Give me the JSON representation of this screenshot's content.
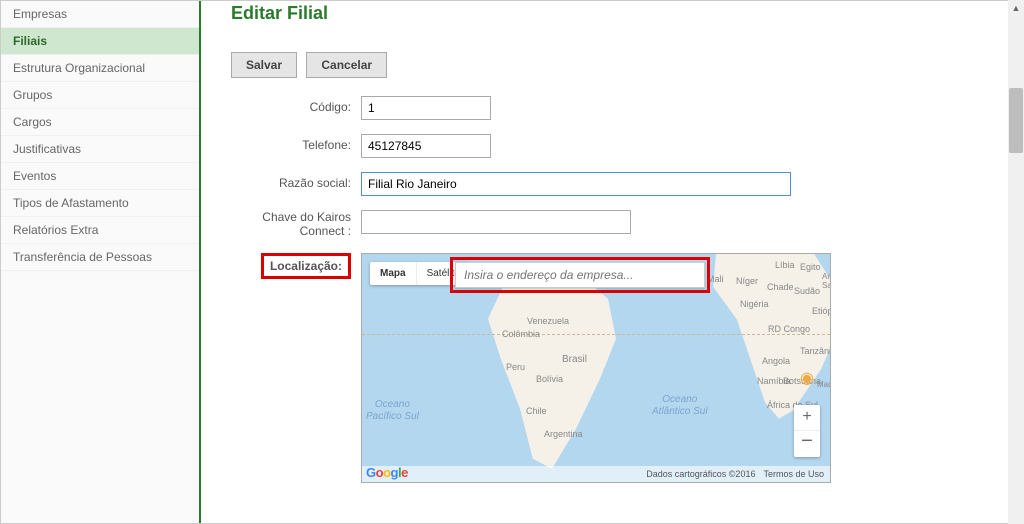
{
  "sidebar": {
    "items": [
      {
        "label": "Empresas"
      },
      {
        "label": "Filiais",
        "active": true
      },
      {
        "label": "Estrutura Organizacional"
      },
      {
        "label": "Grupos"
      },
      {
        "label": "Cargos"
      },
      {
        "label": "Justificativas"
      },
      {
        "label": "Eventos"
      },
      {
        "label": "Tipos de Afastamento"
      },
      {
        "label": "Relatórios Extra"
      },
      {
        "label": "Transferência de Pessoas"
      }
    ]
  },
  "page": {
    "title": "Editar Filial"
  },
  "buttons": {
    "save": "Salvar",
    "cancel": "Cancelar"
  },
  "form": {
    "codigo": {
      "label": "Código:",
      "value": "1"
    },
    "telefone": {
      "label": "Telefone:",
      "value": "45127845"
    },
    "razao": {
      "label": "Razão social:",
      "value": "Filial Rio Janeiro"
    },
    "chave": {
      "label_line1": "Chave do Kairos",
      "label_line2": "Connect :",
      "value": ""
    },
    "localizacao": {
      "label": "Localização:"
    }
  },
  "map": {
    "controls": {
      "map": "Mapa",
      "satellite": "Satélite"
    },
    "search_placeholder": "Insira o endereço da empresa...",
    "ocean_pacifico": "Oceano\nPacífico Sul",
    "ocean_atlantico": "Oceano\nAtlântico Sul",
    "countries": {
      "venezuela": "Venezuela",
      "colombia": "Colômbia",
      "peru": "Peru",
      "bolivia": "Bolívia",
      "brasil": "Brasil",
      "chile": "Chile",
      "argentina": "Argentina",
      "mali": "Mali",
      "niger": "Níger",
      "chade": "Chade",
      "sudao": "Sudão",
      "nigeria": "Nigéria",
      "etiopia": "Etiópia",
      "rdcongo": "RD Congo",
      "tanzania": "Tanzânia",
      "angola": "Angola",
      "namibia": "Namíbia",
      "botsuana": "Botsuana",
      "africasul": "África do Sul",
      "madagascar": "Madagascar",
      "libia": "Líbia",
      "egito": "Egito",
      "arabia": "Arábia Saudita"
    },
    "footer_copyright": "Dados cartográficos ©2016",
    "footer_terms": "Termos de Uso",
    "zoom_in": "+",
    "zoom_out": "−"
  }
}
